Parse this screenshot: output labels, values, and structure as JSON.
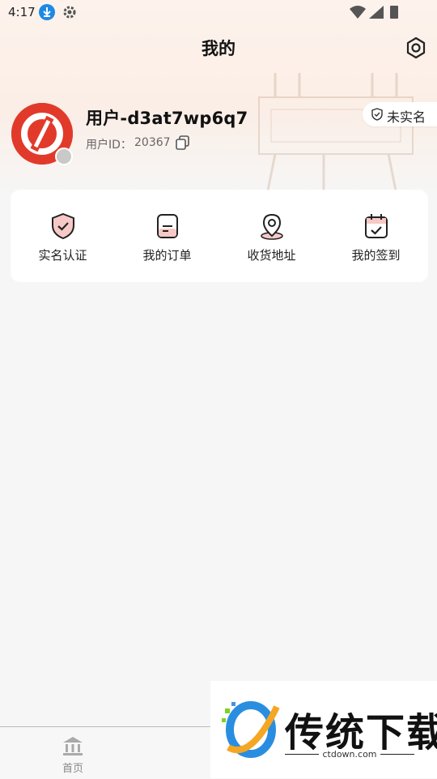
{
  "status_bar": {
    "time": "4:17"
  },
  "header": {
    "title": "我的"
  },
  "profile": {
    "username": "用户-d3at7wp6q7",
    "uid_label": "用户ID：",
    "uid_value": "20367",
    "realname_status": "未实名"
  },
  "quick_actions": [
    {
      "label": "实名认证",
      "icon": "shield-check-icon"
    },
    {
      "label": "我的订单",
      "icon": "order-doc-icon"
    },
    {
      "label": "收货地址",
      "icon": "location-pin-icon"
    },
    {
      "label": "我的签到",
      "icon": "calendar-check-icon"
    }
  ],
  "bottom_nav": {
    "items": [
      {
        "label": "首页",
        "icon": "bank-building-icon"
      }
    ]
  },
  "watermark": {
    "title": "传统下载",
    "url": "ctdown.com"
  },
  "colors": {
    "accent_red": "#e23a2a",
    "icon_pink": "#f7c9c6",
    "background": "#f6f6f6"
  }
}
